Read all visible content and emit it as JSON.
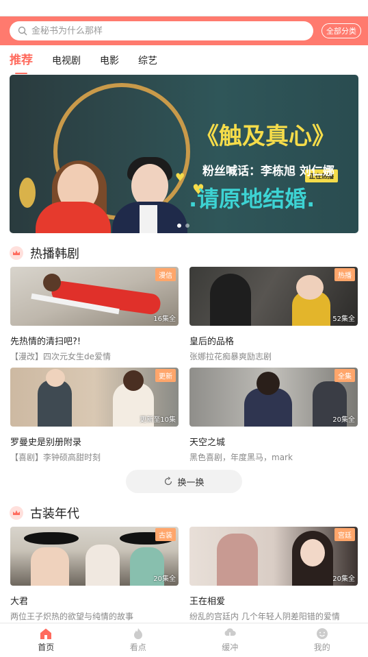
{
  "search": {
    "placeholder": "金秘书为什么那样",
    "all_categories": "全部分类"
  },
  "tabs": [
    {
      "label": "推荐"
    },
    {
      "label": "电视剧"
    },
    {
      "label": "电影"
    },
    {
      "label": "综艺"
    }
  ],
  "banner": {
    "badge": "正在热播",
    "title": "《触及真心》",
    "subtitle": "粉丝喊话：李栋旭 刘仁娜",
    "tagline": ".请原地结婚."
  },
  "sections": [
    {
      "title": "热播韩剧",
      "items": [
        {
          "title": "先热情的清扫吧?!",
          "desc": "【漫改】四次元女生de爱情",
          "tag": "漫信",
          "episodes": "16集全"
        },
        {
          "title": "皇后的品格",
          "desc": "张娜拉花痴暴爽励志剧",
          "tag": "热播",
          "episodes": "52集全"
        },
        {
          "title": "罗曼史是别册附录",
          "desc": "【喜剧】李钟硕高甜时刻",
          "tag": "更新",
          "episodes": "更新至10集"
        },
        {
          "title": "天空之城",
          "desc": "黑色喜剧，年度黑马，mark",
          "tag": "全集",
          "episodes": "20集全"
        }
      ]
    },
    {
      "title": "古装年代",
      "items": [
        {
          "title": "大君",
          "desc": "两位王子炽热的欲望与纯情的故事",
          "tag": "古装",
          "episodes": "20集全"
        },
        {
          "title": "王在相爱",
          "desc": "纷乱的宫廷内 几个年轻人阴差阳错的爱情",
          "tag": "宫廷",
          "episodes": "20集全"
        }
      ]
    }
  ],
  "refresh_label": "换一换",
  "bottom_nav": [
    {
      "label": "首页",
      "icon": "home-icon"
    },
    {
      "label": "看点",
      "icon": "flame-icon"
    },
    {
      "label": "缓冲",
      "icon": "cloud-download-icon"
    },
    {
      "label": "我的",
      "icon": "smile-icon"
    }
  ],
  "colors": {
    "accent": "#ff6b5e",
    "header": "#ff7a6e",
    "tag": "#ffa66b"
  }
}
